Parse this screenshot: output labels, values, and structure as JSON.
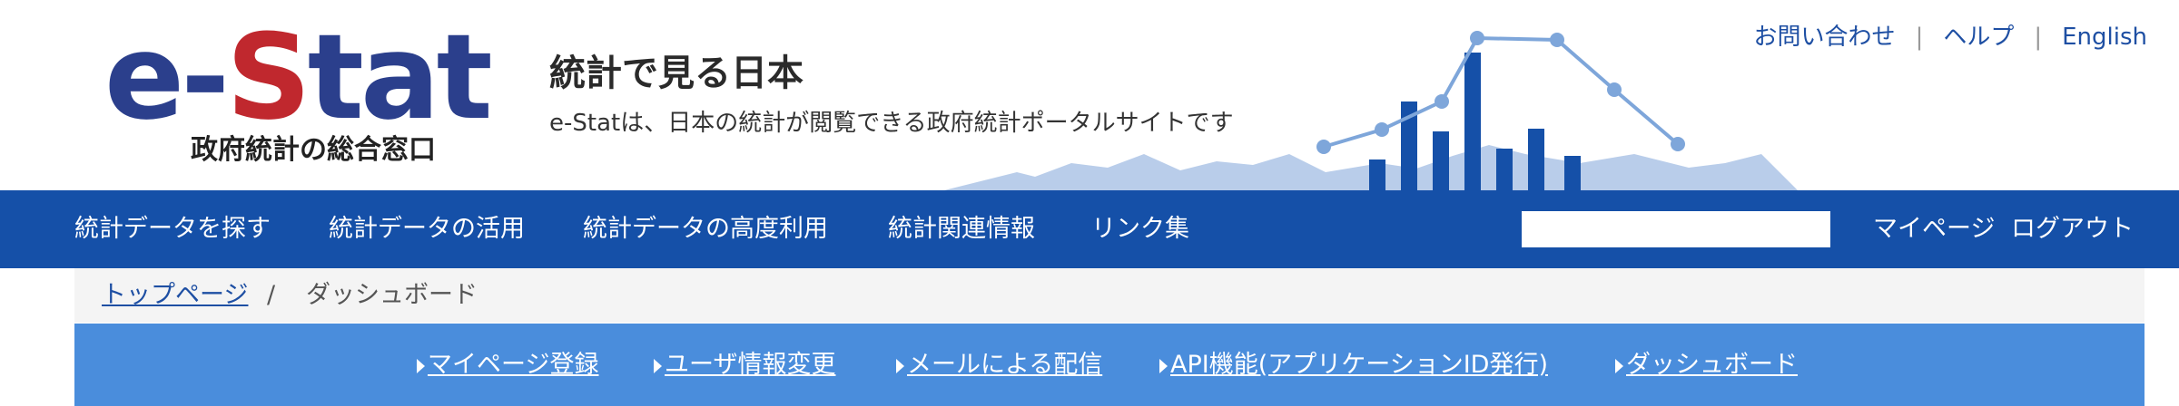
{
  "logo": {
    "e_part": "e-",
    "s_part": "S",
    "tat_part": "tat",
    "subtitle": "政府統計の総合窓口"
  },
  "header": {
    "title": "統計で見る日本",
    "description": "e-Statは、日本の統計が閲覧できる政府統計ポータルサイトです"
  },
  "utility": {
    "contact": "お問い合わせ",
    "help": "ヘルプ",
    "english": "English",
    "separator": "|"
  },
  "nav": {
    "items": [
      "統計データを探す",
      "統計データの活用",
      "統計データの高度利用",
      "統計関連情報",
      "リンク集"
    ],
    "search": {
      "value": "",
      "placeholder": ""
    },
    "mypage": "マイページ",
    "logout": "ログアウト"
  },
  "breadcrumb": {
    "home": "トップページ",
    "separator": "/",
    "current": "ダッシュボード"
  },
  "subnav": {
    "items": [
      "マイページ登録",
      "ユーザ情報変更",
      "メールによる配信",
      "API機能(アプリケーションID発行)",
      "ダッシュボード"
    ]
  },
  "colors": {
    "brand_blue": "#1550a8",
    "subnav_blue": "#4a8ddc",
    "logo_red": "#c0282e",
    "logo_navy": "#2b3f8c"
  }
}
